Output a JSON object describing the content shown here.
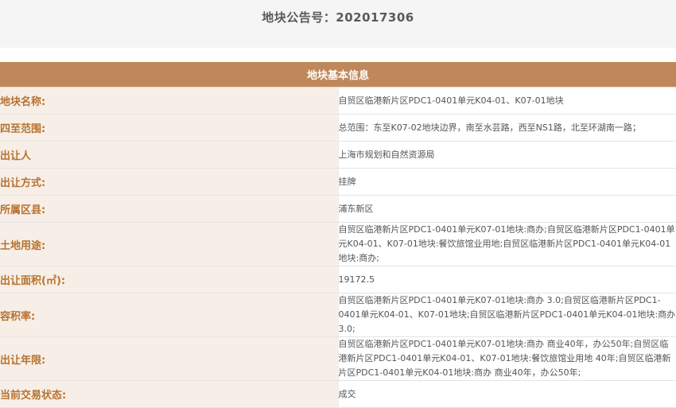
{
  "header": {
    "title": "地块公告号：202017306"
  },
  "section": {
    "title": "地块基本信息"
  },
  "rows": [
    {
      "label": "地块名称:",
      "value": "自贸区临港新片区PDC1-0401单元K04-01、K07-01地块"
    },
    {
      "label": "四至范围:",
      "value": "总范围：东至K07-02地块边界，南至水芸路，西至NS1路，北至环湖南一路；"
    },
    {
      "label": "出让人",
      "value": "上海市规划和自然资源局"
    },
    {
      "label": "出让方式:",
      "value": "挂牌"
    },
    {
      "label": "所属区县:",
      "value": "浦东新区"
    },
    {
      "label": "土地用途:",
      "value": "自贸区临港新片区PDC1-0401单元K07-01地块:商办;自贸区临港新片区PDC1-0401单元K04-01、K07-01地块:餐饮旅馆业用地;自贸区临港新片区PDC1-0401单元K04-01地块:商办;"
    },
    {
      "label": "出让面积(㎡):",
      "value": "19172.5"
    },
    {
      "label": "容积率:",
      "value": "自贸区临港新片区PDC1-0401单元K07-01地块:商办 3.0;自贸区临港新片区PDC1-0401单元K04-01、K07-01地块;自贸区临港新片区PDC1-0401单元K04-01地块:商办 3.0;"
    },
    {
      "label": "出让年限:",
      "value": "自贸区临港新片区PDC1-0401单元K07-01地块:商办 商业40年，办公50年;自贸区临港新片区PDC1-0401单元K04-01、K07-01地块:餐饮旅馆业用地 40年;自贸区临港新片区PDC1-0401单元K04-01地块:商办 商业40年，办公50年;"
    },
    {
      "label": "当前交易状态:",
      "value": "成交"
    }
  ]
}
